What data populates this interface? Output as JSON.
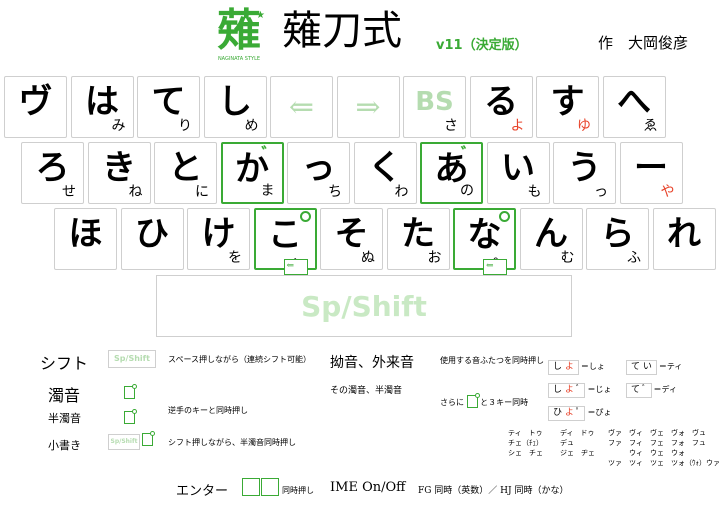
{
  "header": {
    "logo_text": "薙",
    "logo_sub": "NAGINATA STYLE",
    "title": "薙刀式",
    "version": "v11（決定版）",
    "author": "作　大岡俊彦"
  },
  "colors": {
    "accent": "#3aaa35",
    "red": "#e8432a",
    "light_green": "#b5dcb0"
  },
  "rows": [
    {
      "keys": [
        {
          "main": "ヴ",
          "sub": ""
        },
        {
          "main": "は",
          "sub": "み"
        },
        {
          "main": "て",
          "sub": "り"
        },
        {
          "main": "し",
          "sub": "め"
        },
        {
          "main": "⇐",
          "sub": "",
          "type": "arrow"
        },
        {
          "main": "⇒",
          "sub": "",
          "type": "arrow"
        },
        {
          "main": "BS",
          "sub": "さ",
          "type": "bs"
        },
        {
          "main": "る",
          "sub": "よ",
          "red": true
        },
        {
          "main": "す",
          "sub": "ゆ",
          "red": true
        },
        {
          "main": "へ",
          "sub": "ゑ"
        }
      ]
    },
    {
      "keys": [
        {
          "main": "ろ",
          "sub": "せ"
        },
        {
          "main": "き",
          "sub": "ね"
        },
        {
          "main": "と",
          "sub": "に"
        },
        {
          "main": "か",
          "sub": "ま",
          "highlight": true,
          "mark": "dakuten"
        },
        {
          "main": "っ",
          "sub": "ち"
        },
        {
          "main": "く",
          "sub": "わ"
        },
        {
          "main": "あ",
          "sub": "の",
          "highlight": true,
          "mark": "dakuten"
        },
        {
          "main": "い",
          "sub": "も"
        },
        {
          "main": "う",
          "sub": "っ"
        },
        {
          "main": "ー",
          "sub": "や",
          "red": true
        }
      ]
    },
    {
      "keys": [
        {
          "main": "ほ",
          "sub": ""
        },
        {
          "main": "ひ",
          "sub": ""
        },
        {
          "main": "け",
          "sub": "を"
        },
        {
          "main": "こ",
          "sub": "、",
          "highlight": true,
          "mark": "handakuten",
          "enter": true
        },
        {
          "main": "そ",
          "sub": "ぬ"
        },
        {
          "main": "た",
          "sub": "お"
        },
        {
          "main": "な",
          "sub": "。",
          "highlight": true,
          "mark": "handakuten",
          "enter": true
        },
        {
          "main": "ん",
          "sub": "む"
        },
        {
          "main": "ら",
          "sub": "ふ"
        },
        {
          "main": "れ",
          "sub": ""
        }
      ]
    }
  ],
  "space_key": "Sp/Shift",
  "legend": {
    "shift_title": "シフト",
    "shift_chip": "Sp/Shift",
    "shift_desc": "スペース押しながら（連続シフト可能）",
    "dakuon_title": "濁音",
    "handakuon_title": "半濁音",
    "dakuon_desc": "逆手のキーと同時押し",
    "kogaki_title": "小書き",
    "kogaki_chip": "Sp/Shift",
    "kogaki_desc": "シフト押しながら、半濁音同時押し",
    "youon_title": "拗音、外来音",
    "youon_desc1": "使用する音ふたつを同時押し",
    "youon_desc2": "その濁音、半濁音",
    "youon_desc3": "さらに",
    "youon_desc3b": "と３キー同時",
    "combo1": [
      {
        "a": "し",
        "b": "よ",
        "result": "＝しょ"
      },
      {
        "a": "て",
        "b": "い",
        "result": "＝ティ"
      }
    ],
    "combo2": [
      {
        "a": "し",
        "b": "よ",
        "result": "＝じょ"
      },
      {
        "a": "て",
        "b": "",
        "result": "＝ディ"
      }
    ],
    "combo3": [
      {
        "a": "ひ",
        "b": "よ",
        "result": "＝ぴょ"
      }
    ],
    "extra_table_left": [
      "ティ　トゥ",
      "チェ（ﾁｪ）",
      "シェ　チェ"
    ],
    "extra_table_mid": [
      "ディ　ドゥ",
      "デュ",
      "ジェ　ヂェ"
    ],
    "extra_table_right": [
      "ヴァ　ヴィ　ヴェ　ヴォ　ヴュ",
      "ファ　フィ　フェ　フォ　フュ",
      "　　　ウィ　ウェ　ウォ",
      "ツァ　ツィ　ツェ　ツォ（ｳｫ）ウァ行"
    ],
    "enter_title": "エンター",
    "enter_desc": "同時押し",
    "ime_title": "IME On/Off",
    "ime_desc": "FG 同時（英数）／ HJ 同時（かな）"
  }
}
